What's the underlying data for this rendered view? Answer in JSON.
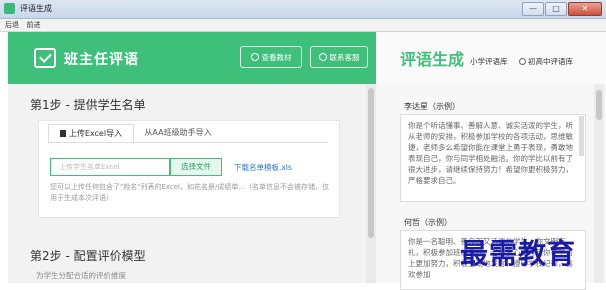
{
  "window": {
    "title": "评语生成",
    "min": "—",
    "max": "□",
    "close": "✕"
  },
  "menu": [
    "后退",
    "前进"
  ],
  "header": {
    "brand": "班主任评语",
    "btn_materials": "查看教材",
    "btn_support": "联系客服"
  },
  "right_header": {
    "title": "评语生成",
    "option_primary": "小学评语库",
    "option_middle": "初高中评语库"
  },
  "step1": {
    "title": "第1步 - 提供学生名单",
    "tabs": [
      "上传Excel导入",
      "从AA班级助手导入"
    ],
    "file_placeholder": "上传学生名单Excel",
    "choose_file": "选择文件",
    "download_template": "下载名单模板.xls",
    "note": "您可以上传任何包含了\"姓名\"列表的Excel，如花名册/成绩单...（名单信息不会被存储，仅用于生成本次评语）"
  },
  "step2": {
    "title": "第2步 - 配置评价模型",
    "subtitle": "为学生分配合适的评价维度"
  },
  "students": [
    {
      "name": "李达星（示例）",
      "comment": "你是个听话懂事、善解人意、诚实活泼的学生，听从老师的安排，积极参加学校的各项活动，思维敏捷，老师多么希望你能在课堂上勇于表现，勇敢地表现自己，你与同学相处融洽。你的学比以前有了很大进步，请继续保持努力！希望你更积极努力，严格要求自己。"
    },
    {
      "name": "何哲（示例）",
      "comment": "你是一名聪明、善良而又活泼的学生。你文明有礼，积极参加班级活动，老师衷心地希望你在学习上更加努力，积极主动地发言，遵守学校纪律，喜欢参加"
    }
  ],
  "watermark": "最需教育"
}
